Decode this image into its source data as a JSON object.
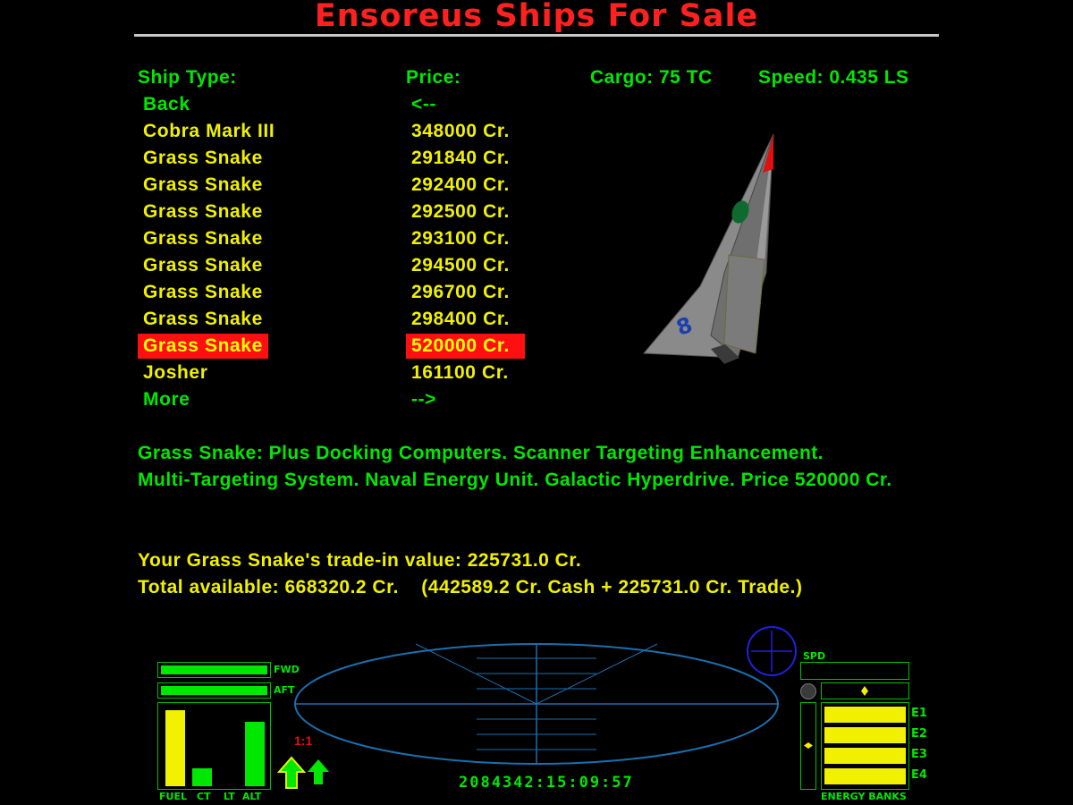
{
  "screen": {
    "title": "Ensoreus Ships For Sale"
  },
  "columns": {
    "ship_type": "Ship Type:",
    "price": "Price:",
    "cargo": "Cargo: 75 TC",
    "speed": "Speed: 0.435 LS"
  },
  "ships": [
    {
      "name": "Back",
      "price": "<--",
      "color": "green"
    },
    {
      "name": "Cobra Mark III",
      "price": "348000 Cr.",
      "color": "yellow"
    },
    {
      "name": "Grass Snake",
      "price": "291840 Cr.",
      "color": "yellow"
    },
    {
      "name": "Grass Snake",
      "price": "292400 Cr.",
      "color": "yellow"
    },
    {
      "name": "Grass Snake",
      "price": "292500 Cr.",
      "color": "yellow"
    },
    {
      "name": "Grass Snake",
      "price": "293100 Cr.",
      "color": "yellow"
    },
    {
      "name": "Grass Snake",
      "price": "294500 Cr.",
      "color": "yellow"
    },
    {
      "name": "Grass Snake",
      "price": "296700 Cr.",
      "color": "yellow"
    },
    {
      "name": "Grass Snake",
      "price": "298400 Cr.",
      "color": "yellow"
    },
    {
      "name": "Grass Snake",
      "price": "520000 Cr.",
      "color": "yellow",
      "selected": true
    },
    {
      "name": "Josher",
      "price": "161100 Cr.",
      "color": "yellow"
    },
    {
      "name": "More",
      "price": "-->",
      "color": "green"
    }
  ],
  "description": {
    "line1": "Grass Snake: Plus Docking Computers. Scanner Targeting Enhancement.",
    "line2": "Multi-Targeting System. Naval Energy Unit. Galactic Hyperdrive. Price 520000 Cr."
  },
  "trade": {
    "line1": "Your Grass Snake's trade-in value: 225731.0 Cr.",
    "line2": "Total available: 668320.2 Cr.    (442589.2 Cr. Cash + 225731.0 Cr. Trade.)"
  },
  "hud": {
    "fwd_label": "FWD",
    "aft_label": "AFT",
    "fwd_shield": 1.0,
    "aft_shield": 1.0,
    "gauge_labels": [
      "FUEL",
      "CT",
      "LT",
      "ALT"
    ],
    "gauge_levels": [
      0.95,
      0.22,
      0.0,
      0.8
    ],
    "scanner_zoom": "1:1",
    "spd_label": "SPD",
    "speed_level": 0.0,
    "energy_bank_labels": [
      "E1",
      "E2",
      "E3",
      "E4"
    ],
    "energy_levels": [
      1.0,
      1.0,
      1.0,
      1.0
    ],
    "energy_banks_label": "ENERGY BANKS",
    "clock": "2084342:15:09:57"
  },
  "colors": {
    "text_green": "#00e800",
    "text_yellow": "#f0f000",
    "title_red": "#ff2020",
    "selection_red": "#ff1010",
    "scanner_blue": "#1a6fae",
    "compass_blue": "#2020e0"
  }
}
